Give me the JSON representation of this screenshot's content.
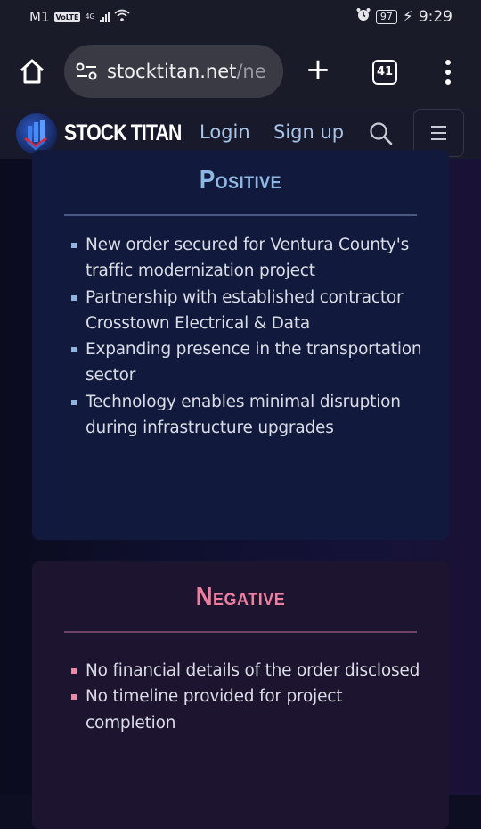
{
  "status_bar": {
    "carrier": "M1",
    "volte": "VoLTE",
    "network": "4G",
    "battery": "97",
    "time": "9:29"
  },
  "browser": {
    "url_host": "stocktitan.net",
    "url_path": "/ne",
    "tab_count": "41"
  },
  "site_nav": {
    "brand": "STOCK TITAN",
    "login": "Login",
    "signup": "Sign up"
  },
  "positive": {
    "title": "Positive",
    "items": [
      "New order secured for Ventura County's traffic modernization project",
      "Partnership with established contractor Crosstown Electrical & Data",
      "Expanding presence in the transportation sector",
      "Technology enables minimal disruption during infrastructure upgrades"
    ],
    "accent_color": "#8db8e4"
  },
  "negative": {
    "title": "Negative",
    "items": [
      "No financial details of the order disclosed",
      "No timeline provided for project completion"
    ],
    "accent_color": "#ee7fa0"
  }
}
